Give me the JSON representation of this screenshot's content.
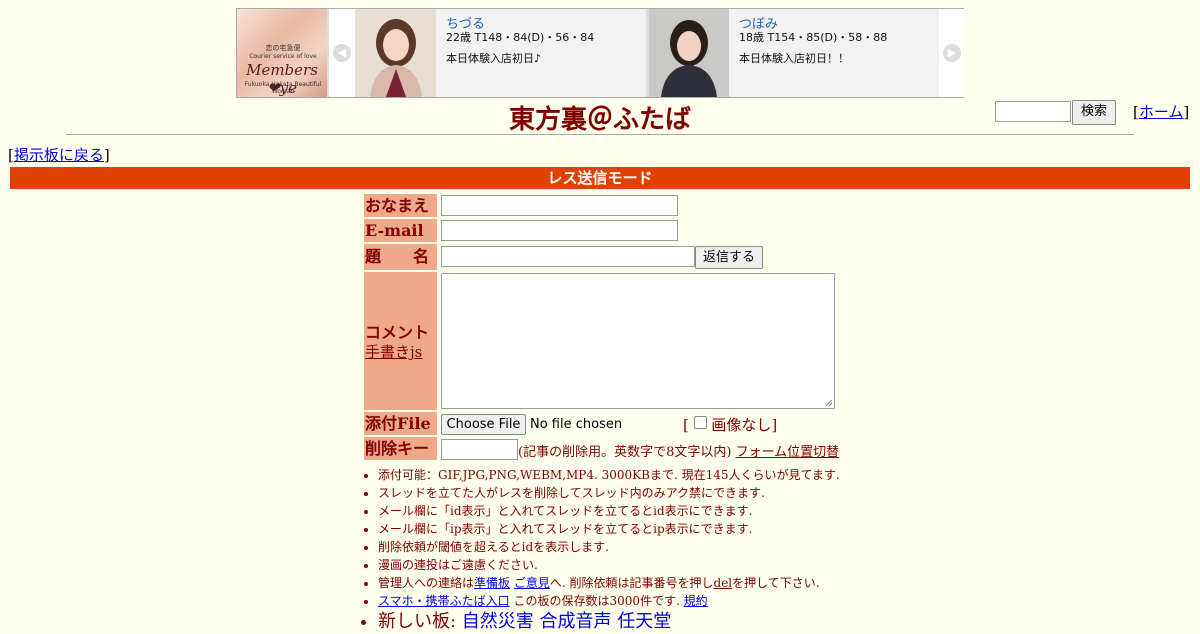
{
  "ad": {
    "logo": {
      "line1": "恋の宅急便",
      "line2": "Courier service of love",
      "line3": "Members ❤ye",
      "line4": "Fukuoka Hakata Beautiful Woman"
    },
    "cards": [
      {
        "name": "ちづる",
        "spec": "22歳 T148・84(D)・56・84",
        "message": "本日体験入店初日♪"
      },
      {
        "name": "つぼみ",
        "spec": "18歳 T154・85(D)・58・88",
        "message": "本日体験入店初日！！"
      }
    ],
    "prev_arrow": "◀",
    "next_arrow": "▶"
  },
  "header": {
    "title": "東方裏＠ふたば",
    "search_button": "検索",
    "home_bracket_open": "[",
    "home_link": "ホーム",
    "home_bracket_close": "]"
  },
  "back_link": {
    "open": "[",
    "label": "掲示板に戻る",
    "close": "]"
  },
  "mode_bar": "レス送信モード",
  "form": {
    "name_label": "おなまえ",
    "email_label": "E-mail",
    "subject_label": "題　　名",
    "submit_button": "返信する",
    "comment_label": "コメント",
    "handwriting_link": "手書きjs",
    "file_label": "添付File",
    "choose_file_button": "Choose File",
    "no_file_text": "No file chosen",
    "no_image_open": "[",
    "no_image_label": "画像なし]",
    "delete_key_label": "削除キー",
    "delete_key_note": "(記事の削除用。英数字で8文字以内)",
    "form_position_link": "フォーム位置切替"
  },
  "notes": {
    "n1": "添付可能：GIF,JPG,PNG,WEBM,MP4. 3000KBまで. 現在145人くらいが見てます.",
    "n2": "スレッドを立てた人がレスを削除してスレッド内のみアク禁にできます.",
    "n3": "メール欄に「id表示」と入れてスレッドを立てるとid表示にできます.",
    "n4": "メール欄に「ip表示」と入れてスレッドを立てるとip表示にできます.",
    "n5": "削除依頼が閾値を超えるとidを表示します.",
    "n6": "漫画の連投はご遠慮ください.",
    "n7_pre": "管理人への連絡は",
    "n7_link1": "準備板",
    "n7_link2": "ご意見",
    "n7_mid": "へ. 削除依頼は記事番号を押し",
    "n7_link3": "del",
    "n7_post": "を押して下さい.",
    "n8_link": "スマホ・携帯ふたば入口",
    "n8_text": " この板の保存数は3000件です.",
    "n8_link2": "規約",
    "n9_pre": "新しい板: ",
    "n9_link1": "自然災害",
    "n9_link2": "合成音声",
    "n9_link3": "任天堂"
  },
  "colors": {
    "background": "#ffffee",
    "mode_bar": "#e04000",
    "label_bg": "#eeaa88",
    "text": "#800000"
  }
}
